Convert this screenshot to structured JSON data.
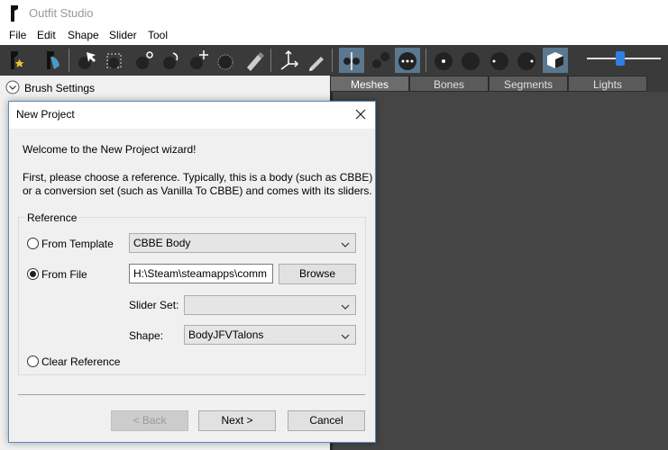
{
  "window": {
    "title": "Outfit Studio"
  },
  "menu": [
    "File",
    "Edit",
    "Shape",
    "Slider",
    "Tool"
  ],
  "toolbar": {
    "tools": [
      "new-project-icon",
      "load-outfit-icon",
      "select-brush-icon",
      "mask-brush-icon",
      "inflate-brush-icon",
      "deflate-brush-icon",
      "move-brush-icon",
      "smooth-brush-icon",
      "weight-brush-icon",
      "transform-icon",
      "pen-icon",
      "view-front-icon",
      "view-side-icon",
      "view-back-icon",
      "light-1-icon",
      "light-2-icon",
      "light-3-icon",
      "light-4-icon",
      "cube-icon"
    ],
    "zoom_slider": 0.45
  },
  "left_panel": {
    "brush_settings_label": "Brush Settings"
  },
  "right_panel": {
    "tabs": [
      "Meshes",
      "Bones",
      "Segments",
      "Lights"
    ],
    "active_tab": "Meshes"
  },
  "dialog": {
    "title": "New Project",
    "welcome": "Welcome to the New Project wizard!",
    "instructions_line1": "First, please choose a reference. Typically, this is a body (such as CBBE)",
    "instructions_line2": "or a conversion set (such as Vanilla To CBBE) and comes with its sliders.",
    "reference_group_label": "Reference",
    "from_template": {
      "label": "From Template",
      "value": "CBBE Body",
      "selected": false
    },
    "from_file": {
      "label": "From File",
      "path": "H:\\Steam\\steamapps\\comm",
      "browse_label": "Browse",
      "selected": true
    },
    "slider_set": {
      "label": "Slider Set:",
      "value": ""
    },
    "shape": {
      "label": "Shape:",
      "value": "BodyJFVTalons"
    },
    "clear_reference": {
      "label": "Clear Reference",
      "selected": false
    },
    "buttons": {
      "back": "< Back",
      "next": "Next >",
      "cancel": "Cancel"
    }
  },
  "colors": {
    "toolbar_bg": "#3a3a3a",
    "active_tool": "#5a7890",
    "accent": "#2f80e0",
    "dialog_border": "#5a8ac0"
  }
}
